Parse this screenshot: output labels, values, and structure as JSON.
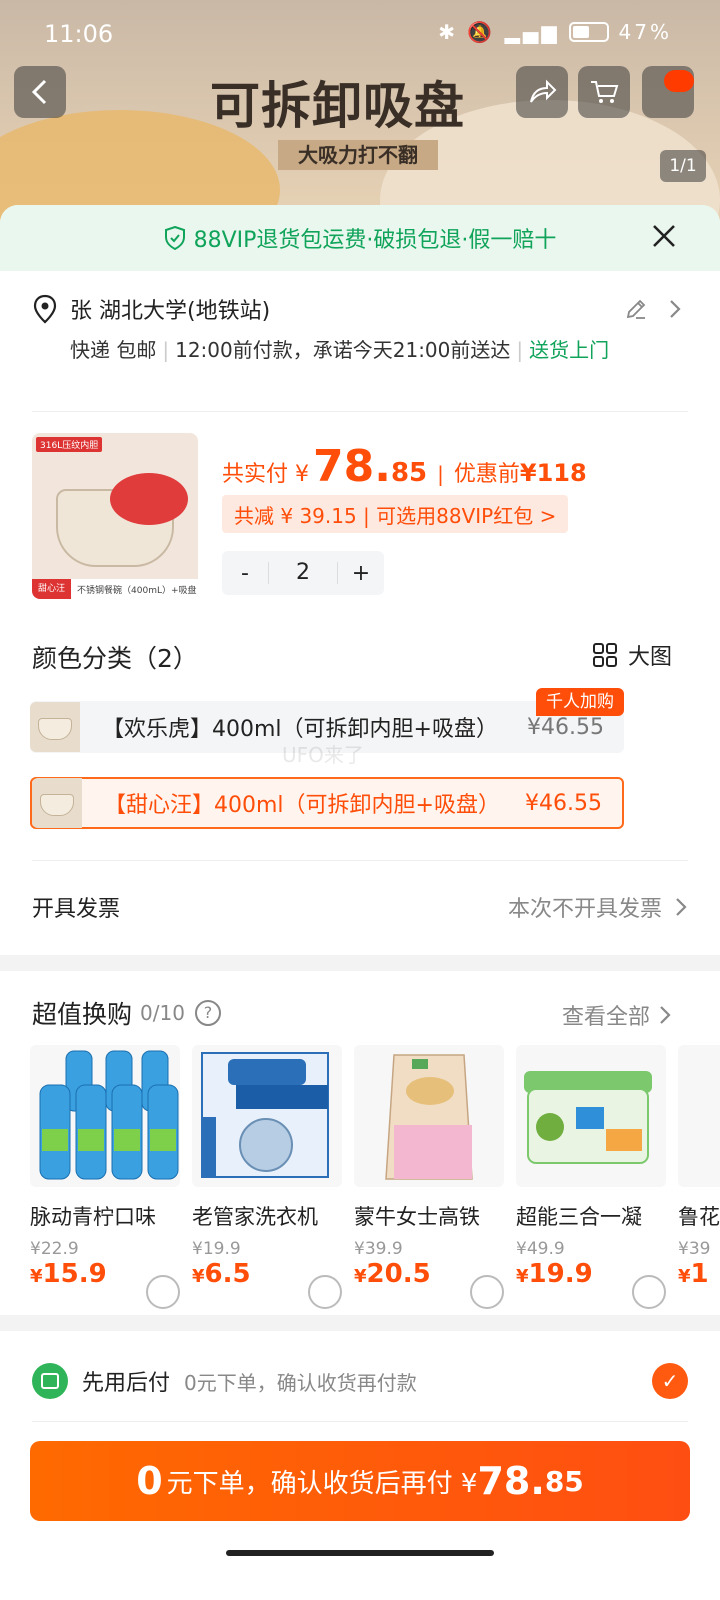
{
  "status_bar": {
    "time": "11:06",
    "battery": "47%"
  },
  "hero": {
    "title": "可拆卸吸盘",
    "subtitle": "大吸力打不翻",
    "pager": "1/1"
  },
  "vip_bar": {
    "text": "88VIP退货包运费·破损包退·假一赔十"
  },
  "address": {
    "name_location": "张 湖北大学(地铁站)",
    "shipping": "快递 包邮",
    "promise": "12:00前付款，承诺今天21:00前送达",
    "delivery": "送货上门"
  },
  "product": {
    "image_tag": "316L压纹内胆",
    "image_brand": "甜心汪",
    "image_spec": "不锈钢餐碗（400mL）+吸盘",
    "pay_label": "共实付 ¥",
    "price_int": "78.",
    "price_dec": "85",
    "before_label": "优惠前",
    "before_price": "¥118",
    "discount_text": "共减 ¥ 39.15 | 可选用88VIP红包 >",
    "qty_minus": "-",
    "quantity": "2",
    "qty_plus": "+"
  },
  "color_section": {
    "title": "颜色分类（2）",
    "big_image": "大图",
    "options": [
      {
        "name": "【欢乐虎】400ml（可拆卸内胆+吸盘）",
        "price": "¥46.55",
        "badge": "千人加购",
        "selected": false
      },
      {
        "name": "【甜心汪】400ml（可拆卸内胆+吸盘）",
        "price": "¥46.55",
        "selected": true
      }
    ]
  },
  "watermark": "UFO来了",
  "invoice": {
    "label": "开具发票",
    "value": "本次不开具发票"
  },
  "deals": {
    "title": "超值换购",
    "count": "0/10",
    "help": "?",
    "view_all": "查看全部",
    "items": [
      {
        "name": "脉动青柠口味",
        "orig": "¥22.9",
        "currency": "¥",
        "price": "15.9"
      },
      {
        "name": "老管家洗衣机",
        "orig": "¥19.9",
        "currency": "¥",
        "price": "6.5"
      },
      {
        "name": "蒙牛女士高铁",
        "orig": "¥39.9",
        "currency": "¥",
        "price": "20.5"
      },
      {
        "name": "超能三合一凝",
        "orig": "¥49.9",
        "currency": "¥",
        "price": "19.9"
      },
      {
        "name": "鲁花",
        "orig": "¥39",
        "currency": "¥",
        "price": "1"
      }
    ]
  },
  "pay_later": {
    "title": "先用后付",
    "subtitle": "0元下单，确认收货再付款"
  },
  "cta": {
    "zero": "0",
    "text": "元下单，确认收货后再付 ¥",
    "amount": "78.",
    "amount_dec": "85"
  },
  "colors": {
    "accent": "#ff4d0a",
    "vip_green": "#10a35a"
  }
}
